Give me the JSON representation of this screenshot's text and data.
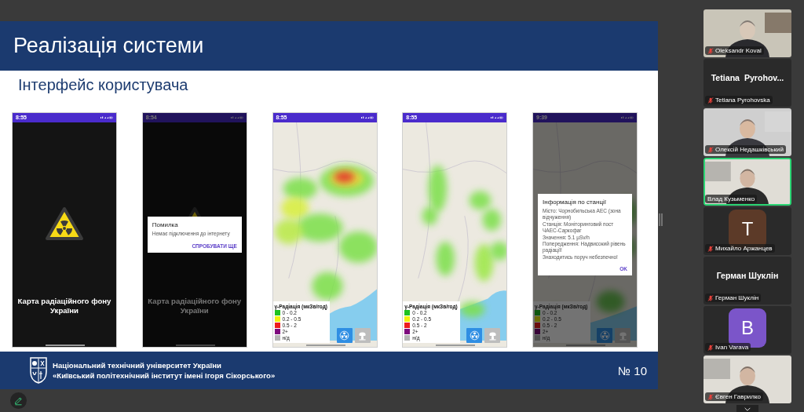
{
  "slide": {
    "title": "Реалізація системи",
    "subtitle": "Інтерфейс користувача",
    "phones": [
      {
        "kind": "splash",
        "time": "8:55",
        "app_title": "Карта радіаційного фону України"
      },
      {
        "kind": "splash",
        "time": "8:54",
        "app_title": "Карта радіаційного фону України",
        "dialog": {
          "title": "Помилка",
          "message": "Немає підключення до інтернету",
          "button": "СПРОБУВАТИ ЩЕ"
        }
      },
      {
        "kind": "map",
        "time": "8:55",
        "legend": {
          "title": "γ-Радіація (мкЗв/год)",
          "items": [
            {
              "label": "0 - 0.2",
              "color": "#1fc21f"
            },
            {
              "label": "0.2 - 0.5",
              "color": "#f2f20d"
            },
            {
              "label": "0.5 - 2",
              "color": "#ee1c1c"
            },
            {
              "label": "2+",
              "color": "#7d0a7d"
            },
            {
              "label": "н/д",
              "color": "#b4b4b4"
            }
          ]
        }
      },
      {
        "kind": "map",
        "time": "8:55",
        "legend": {
          "title": "γ-Радіація (мкЗв/год)",
          "items": [
            {
              "label": "0 - 0.2",
              "color": "#1fc21f"
            },
            {
              "label": "0.2 - 0.5",
              "color": "#f2f20d"
            },
            {
              "label": "0.5 - 2",
              "color": "#ee1c1c"
            },
            {
              "label": "2+",
              "color": "#7d0a7d"
            },
            {
              "label": "н/д",
              "color": "#b4b4b4"
            }
          ]
        }
      },
      {
        "kind": "map",
        "time": "9:39",
        "legend": {
          "title": "γ-Радіація (мкЗв/год)",
          "items": [
            {
              "label": "0 - 0.2",
              "color": "#0e570e"
            },
            {
              "label": "0.2 - 0.5",
              "color": "#6d6d06"
            },
            {
              "label": "0.5 - 2",
              "color": "#6b0d0d"
            },
            {
              "label": "2+",
              "color": "#380438"
            },
            {
              "label": "н/д",
              "color": "#515151"
            }
          ]
        },
        "dialog": {
          "title": "Інформація по станції",
          "lines": [
            "Місто: Чорнобильська АЕС (зона відчуження)",
            "Станція: Моніторинговий пост ЧАЕС-Саркофаг",
            "Значення: 5.1 µSv/h",
            "Попередження: Надвисокий рівень радіації!",
            "Знаходитись поруч небезпечно!"
          ],
          "button": "OK"
        }
      }
    ],
    "footer": {
      "lines": [
        "Національний технічний університет України",
        "«Київський політехнічний інститут імені Ігоря Сікорського»"
      ],
      "page": "№ 10"
    }
  },
  "participants": [
    {
      "kind": "video",
      "name": "Oleksandr Koval",
      "muted": true,
      "speaking": false
    },
    {
      "kind": "name",
      "display_name": "Tetiana  Pyrohov...",
      "name": "Tetiana Pyrohovska",
      "muted": true,
      "speaking": false
    },
    {
      "kind": "video",
      "name": "Олексій Недашківський",
      "muted": true,
      "speaking": false
    },
    {
      "kind": "video",
      "name": "Влад Кузьменко",
      "muted": false,
      "speaking": true
    },
    {
      "kind": "avatar",
      "initial": "T",
      "color": "#5c3a28",
      "name": "Михайло Аржанцев",
      "muted": true,
      "speaking": false
    },
    {
      "kind": "name",
      "display_name": "Герман Шуклін",
      "name": "Герман Шуклін",
      "muted": true,
      "speaking": false
    },
    {
      "kind": "avatar",
      "initial": "B",
      "color": "#7b55c9",
      "name": "Ivan Varava",
      "muted": true,
      "speaking": false
    },
    {
      "kind": "video",
      "name": "Євген Гаврилко",
      "muted": true,
      "speaking": false
    }
  ]
}
